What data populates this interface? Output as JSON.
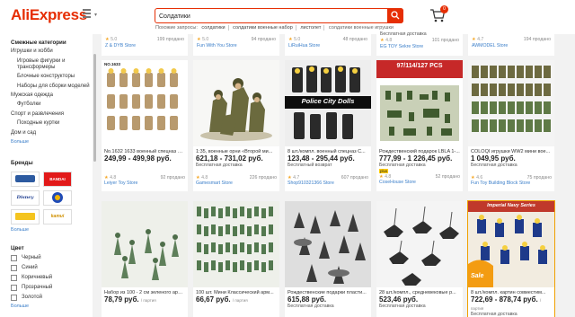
{
  "header": {
    "logo": "AliExpress",
    "search_value": "Солдатики",
    "related_label": "Похожие запросы:",
    "related": [
      "солдатики",
      "солдатики военные набор",
      "листолет",
      "солдатики военные игрушки"
    ],
    "cart_count": "0"
  },
  "sidebar": {
    "categories_title": "Смежные категории",
    "categories": [
      {
        "label": "Игрушки и хобби",
        "level": 0
      },
      {
        "label": "Игровые фигурки и трансформеры",
        "level": 1
      },
      {
        "label": "Блочные конструкторы",
        "level": 1
      },
      {
        "label": "Наборы для сборки моделей",
        "level": 1
      },
      {
        "label": "Мужская одежда",
        "level": 0
      },
      {
        "label": "Футболки",
        "level": 1
      },
      {
        "label": "Спорт и развлечения",
        "level": 0
      },
      {
        "label": "Походные куртки",
        "level": 1
      },
      {
        "label": "Дом и сад",
        "level": 0
      }
    ],
    "more": "Больше",
    "brands_title": "Бренды",
    "brands": [
      "Disney",
      "BANDAI",
      "Disney",
      "Hasbro",
      "KAMUI",
      "kamui"
    ],
    "brands_more": "Больше",
    "color_title": "Цвет",
    "colors": [
      "Черный",
      "Синий",
      "Коричневый",
      "Прозрачный",
      "Золотой"
    ],
    "colors_more": "Больше"
  },
  "top_row": [
    {
      "rating": "5.0",
      "sold": "199 продано",
      "store": "Z & DYB Store"
    },
    {
      "rating": "5.0",
      "sold": "94 продано",
      "store": "Fun With You Store"
    },
    {
      "rating": "5.0",
      "sold": "48 продано",
      "store": "LiRuiHua Store"
    },
    {
      "ship": "Бесплатная доставка",
      "rating": "4.8",
      "sold": "101 продано",
      "store": "EG TOY Sekre Store"
    },
    {
      "rating": "4.7",
      "sold": "194 продано",
      "store": "AWMODEL Store"
    }
  ],
  "products_row1": [
    {
      "img_label": "NO.1633",
      "title": "No.1632 1633 военный спецназ С...",
      "price": "249,99 - 499,98 руб.",
      "ship": "",
      "rating": "4.8",
      "sold": "92 продано",
      "store": "Leiyer Toy Store"
    },
    {
      "img_label": "",
      "title": "1:35, военные орни «Второй ми...",
      "price": "621,18 - 731,02 руб.",
      "ship": "Бесплатная доставка",
      "rating": "4.8",
      "sold": "226 продано",
      "store": "Gamesmart Store"
    },
    {
      "img_label": "Police City Dolls",
      "title": "8 шт./компл. военный спецназ С...",
      "price": "123,48 - 295,44 руб.",
      "ship": "Бесплатный возврат",
      "rating": "4.7",
      "sold": "607 продано",
      "store": "Shop910321366 Store"
    },
    {
      "img_label": "97/114/127 PCS",
      "title": "Рождественский подарок LBLA 1-...",
      "price": "777,99 - 1 226,45 руб.",
      "ship": "Бесплатная доставка",
      "badge": "plus",
      "rating": "4.8",
      "sold": "52 продано",
      "store": "CoseHouse Store"
    },
    {
      "img_label": "",
      "title": "COLOQI игрушки WW2 мини вое...",
      "price": "1 049,95 руб.",
      "ship": "Бесплатная доставка",
      "rating": "4.6",
      "sold": "75 продано",
      "store": "Fun Toy Building Block Store"
    }
  ],
  "products_row2": [
    {
      "title": "Набор из 100 - 2 см зеленого арм...",
      "price": "78,79 руб.",
      "price_suffix": "/ партия"
    },
    {
      "title": "100 шт. Мини Классический арм...",
      "price": "66,67 руб.",
      "price_suffix": "/ партия"
    },
    {
      "title": "Рождественские подарки пласти...",
      "price": "615,88 руб.",
      "ship": "Бесплатная доставка"
    },
    {
      "title": "28 шт./компл., средневековые р...",
      "price": "523,46 руб.",
      "ship": "Бесплатная доставка"
    },
    {
      "img_label": "Imperial Navy Series",
      "tag": "Sale",
      "title": "8 шт./компл. картин совместим...",
      "price": "722,69 - 878,74 руб.",
      "price_suffix": "/ партия",
      "ship": "Бесплатная доставка"
    }
  ],
  "colors": {
    "accent": "#e62e04",
    "link": "#3a7ec9",
    "star": "#f5a623"
  }
}
